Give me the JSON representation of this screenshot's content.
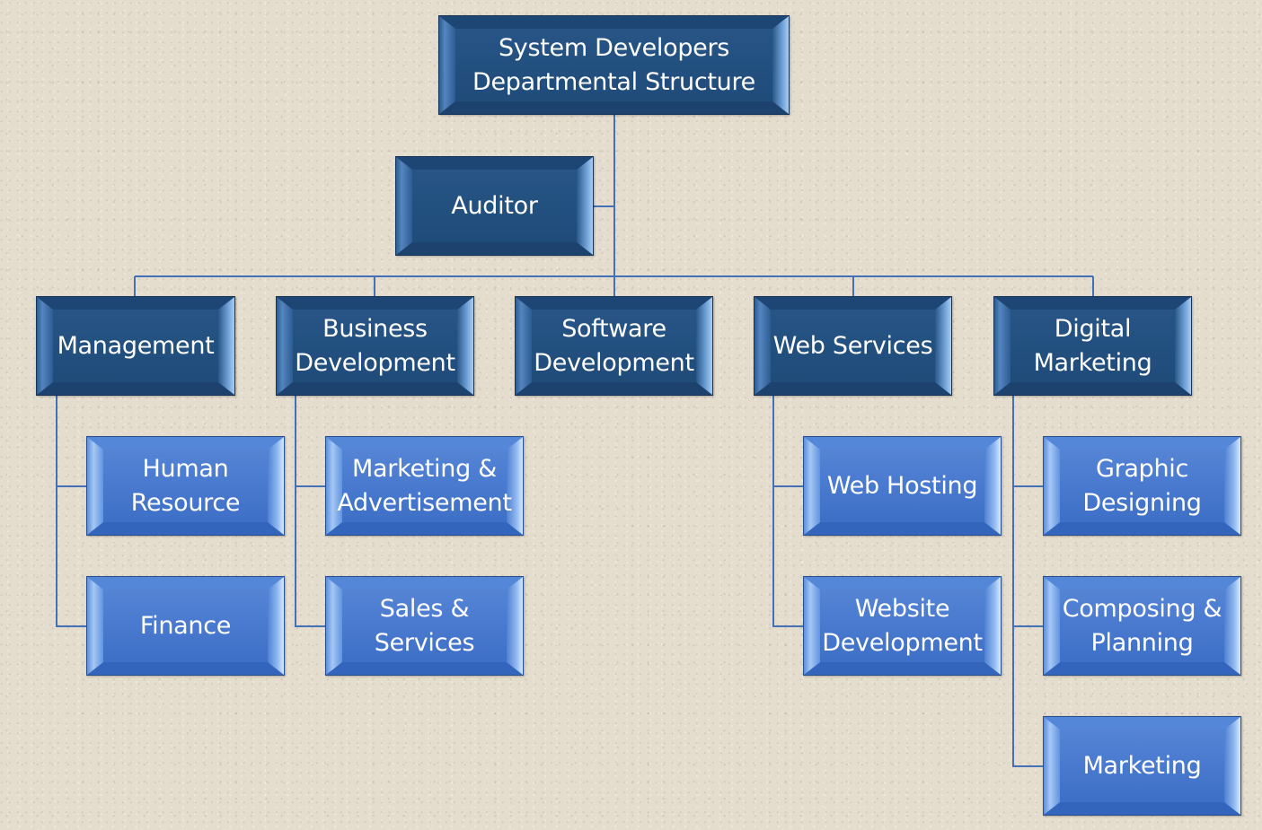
{
  "diagram": {
    "type": "org-chart",
    "title": "System Developers\nDepartmental Structure",
    "colors": {
      "top_level_box": "#22507f",
      "sub_level_box": "#4a7bd0",
      "connector": "#4470b8",
      "background": "#e4dccd",
      "text": "#ffffff"
    },
    "root": {
      "label": "System Developers\nDepartmental Structure",
      "assistant": {
        "label": "Auditor"
      },
      "departments": [
        {
          "label": "Management",
          "children": [
            {
              "label": "Human\nResource"
            },
            {
              "label": "Finance"
            }
          ]
        },
        {
          "label": "Business\nDevelopment",
          "children": [
            {
              "label": "Marketing &\nAdvertisement"
            },
            {
              "label": "Sales &\nServices"
            }
          ]
        },
        {
          "label": "Software\nDevelopment",
          "children": []
        },
        {
          "label": "Web Services",
          "children": [
            {
              "label": "Web Hosting"
            },
            {
              "label": "Website\nDevelopment"
            }
          ]
        },
        {
          "label": "Digital\nMarketing",
          "children": [
            {
              "label": "Graphic\nDesigning"
            },
            {
              "label": "Composing &\nPlanning"
            },
            {
              "label": "Marketing"
            }
          ]
        }
      ]
    }
  }
}
